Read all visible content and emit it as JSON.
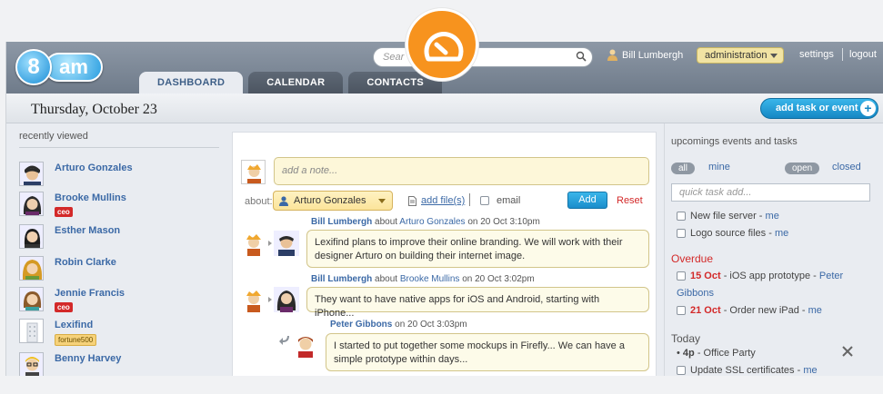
{
  "app": {
    "logo_digit": "8",
    "logo_word": "am"
  },
  "tabs": [
    {
      "label": "DASHBOARD",
      "active": true
    },
    {
      "label": "CALENDAR",
      "active": false
    },
    {
      "label": "CONTACTS",
      "active": false
    }
  ],
  "search": {
    "placeholder": "Sear"
  },
  "user": {
    "name": "Bill Lumbergh",
    "role_select": "administration"
  },
  "toplinks": {
    "settings": "settings",
    "logout": "logout"
  },
  "date": "Thursday, October 23",
  "add_task_button": "add task or event",
  "left": {
    "title": "recently viewed",
    "people": [
      {
        "name": "Arturo Gonzales",
        "badge": ""
      },
      {
        "name": "Brooke Mullins",
        "badge": "ceo"
      },
      {
        "name": "Esther Mason",
        "badge": ""
      },
      {
        "name": "Robin Clarke",
        "badge": ""
      },
      {
        "name": "Jennie Francis",
        "badge": "ceo"
      },
      {
        "name": "Lexifind",
        "badge": "fortune500"
      },
      {
        "name": "Benny Harvey",
        "badge": ""
      }
    ]
  },
  "composer": {
    "note_placeholder": "add a note...",
    "about_label": "about:",
    "about_value": "Arturo Gonzales",
    "add_files": "add file(s)",
    "email_label": "email",
    "add_button": "Add",
    "reset": "Reset"
  },
  "feed": [
    {
      "author": "Bill Lumbergh",
      "about_word": "about",
      "target": "Arturo Gonzales",
      "when": "on 20 Oct 3:10pm",
      "text": "Lexifind plans to improve their online branding. We will work with their designer Arturo on building their internet image."
    },
    {
      "author": "Bill Lumbergh",
      "about_word": "about",
      "target": "Brooke Mullins",
      "when": "on 20 Oct 3:02pm",
      "text": "They want to have native apps for iOS and Android, starting with iPhone..."
    },
    {
      "author": "Peter Gibbons",
      "about_word": "",
      "target": "",
      "when": "on 20 Oct 3:03pm",
      "text": "I started to put together some mockups in Firefly... We can have a simple prototype within days..."
    }
  ],
  "right": {
    "title": "upcomings events and tasks",
    "filter_all": "all",
    "filter_mine": "mine",
    "filter_open": "open",
    "filter_closed": "closed",
    "quick_placeholder": "quick task add...",
    "tasks_top": [
      {
        "text": "New file server - ",
        "me": "me"
      },
      {
        "text": "Logo source files - ",
        "me": "me"
      }
    ],
    "overdue_title": "Overdue",
    "overdue": [
      {
        "date": "15 Oct",
        "text": " - iOS app prototype - ",
        "owner_1": "Peter",
        "owner_2": "Gibbons"
      },
      {
        "date": "21 Oct",
        "text": " - Order new iPad - ",
        "owner": "me"
      }
    ],
    "today_title": "Today",
    "today_event": {
      "time": "4p",
      "text": " - Office Party"
    },
    "today_task": {
      "text": "Update SSL certificates - ",
      "me": "me"
    }
  },
  "colors": {
    "accent_blue": "#1a8dcb",
    "header_gray": "#7a8695",
    "overdue_red": "#d32929",
    "overlay_orange": "#f7931e",
    "note_yellow": "#fdf7d9"
  }
}
